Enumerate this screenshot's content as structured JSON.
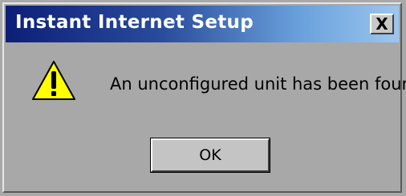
{
  "window": {
    "title": "Instant Internet Setup",
    "close_label": "X"
  },
  "dialog": {
    "icon": "warning-icon",
    "message": "An unconfigured unit has been found",
    "ok_label": "OK"
  },
  "colors": {
    "titlebar_start": "#0c1f78",
    "titlebar_end": "#9cc6ee",
    "dialog_background": "#a8a8a8",
    "warning_yellow": "#ffff00"
  }
}
